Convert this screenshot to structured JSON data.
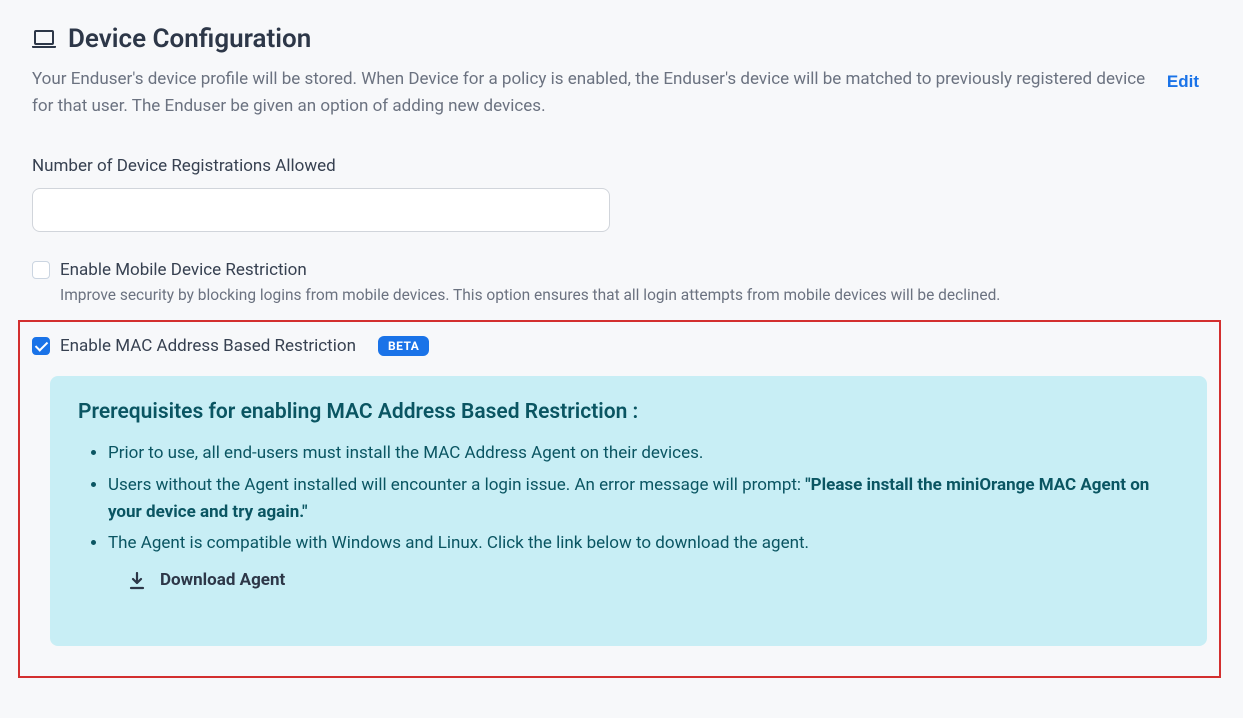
{
  "header": {
    "title": "Device Configuration",
    "edit_label": "Edit",
    "description": "Your Enduser's device profile will be stored. When Device for a policy is enabled, the Enduser's device will be matched to previously registered device for that user. The Enduser be given an option of adding new devices."
  },
  "device_reg": {
    "label": "Number of Device Registrations Allowed",
    "value": ""
  },
  "mobile_restriction": {
    "checked": false,
    "label": "Enable Mobile Device Restriction",
    "hint": "Improve security by blocking logins from mobile devices. This option ensures that all login attempts from mobile devices will be declined."
  },
  "mac_restriction": {
    "checked": true,
    "label": "Enable MAC Address Based Restriction",
    "badge": "BETA",
    "prereq_title": "Prerequisites for enabling MAC Address Based Restriction :",
    "items": [
      "Prior to use, all end-users must install the MAC Address Agent on their devices.",
      "Users without the Agent installed will encounter a login issue. An error message will prompt: ",
      "The Agent is compatible with Windows and Linux. Click the link below to download the agent."
    ],
    "bold_msg": "\"Please install the miniOrange MAC Agent on your device and try again.\"",
    "download_label": "Download Agent"
  }
}
